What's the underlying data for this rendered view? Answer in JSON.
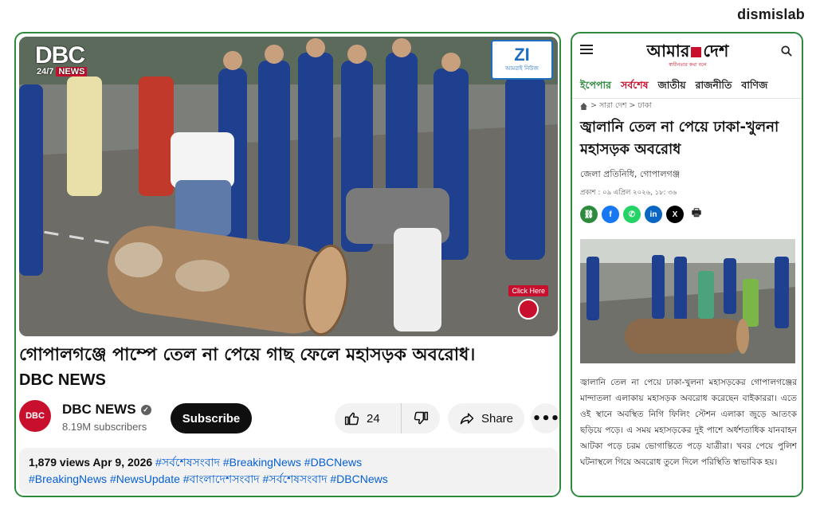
{
  "brand": "dismislab",
  "youtube": {
    "video_logo_main": "DBC",
    "video_logo_sub_prefix": "24/7",
    "video_logo_sub_badge": "NEWS",
    "zi_badge": "ZI",
    "zi_badge_sub": "আমরাই নিউজ",
    "click_here": "Click Here",
    "title": "গোপালগঞ্জে পাম্পে তেল না পেয়ে গাছ ফেলে মহাসড়ক অবরোধ।",
    "subtitle": "DBC NEWS",
    "channel": {
      "avatar_text": "DBC",
      "name": "DBC NEWS",
      "subscribers": "8.19M subscribers"
    },
    "subscribe_label": "Subscribe",
    "likes": "24",
    "share_label": "Share",
    "description": {
      "meta": "1,879 views  Apr 9, 2026",
      "line1_tags": "#সর্বশেষসংবাদ #BreakingNews #DBCNews",
      "line2_tags": "#BreakingNews #NewsUpdate #বাংলাদেশসংবাদ #সর্বশেষসংবাদ #DBCNews"
    }
  },
  "amardesh": {
    "logo_left": "আমার",
    "logo_right": "দেশ",
    "tagline": "স্বাধীনতার কথা বলে",
    "nav": [
      "ইপেপার",
      "সর্বশেষ",
      "জাতীয়",
      "রাজনীতি",
      "বাণিজ"
    ],
    "breadcrumb": "> সারা দেশ > ঢাকা",
    "headline": "জ্বালানি তেল না পেয়ে ঢাকা-খুলনা মহাসড়ক অবরোধ",
    "byline": "জেলা প্রতিনিধি, গোপালগঞ্জ",
    "date": "প্রকাশ : ০৯ এপ্রিল ২০২৬, ১৮: ৩৬",
    "body": "জ্বালানি তেল না পেয়ে ঢাকা-খুলনা মহাসড়কের গোপালগঞ্জের মান্দাতলা এলাকায় মহাসড়ক অবরোধ করেছেন বাইকাররা। এতে ওই স্থানে অবস্থিত নিগি ফিলিং স্টেশন এলাকা জুড়ে আতংক ছড়িয়ে পড়ে। এ সময় মহাসড়কের দুই পাশে অর্ধশতাধিক যানবাহন আটকা পড়ে চরম ভোগান্তিতে পড়ে যাত্রীরা। খবর পেয়ে পুলিশ ঘটনাস্থলে গিয়ে অবরোধ তুলে দিলে পরিস্থিতি স্বাভাবিক হয়।"
  },
  "colors": {
    "frame_green": "#2e8b3e",
    "youtube_link": "#065fd4",
    "accent_red": "#c8102e"
  }
}
